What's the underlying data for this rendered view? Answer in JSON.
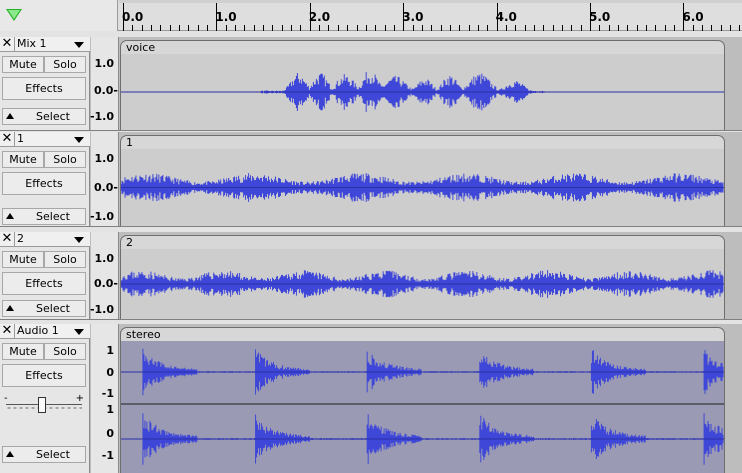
{
  "timeline": {
    "ticks": [
      "0.0",
      "1.0",
      "2.0",
      "3.0",
      "4.0",
      "5.0",
      "6.0"
    ]
  },
  "tracks": [
    {
      "name": "Mix 1",
      "clip": "voice",
      "mute": "Mute",
      "solo": "Solo",
      "effects": "Effects",
      "select": "Select",
      "scale": [
        "1.0",
        "0.0-",
        "-1.0"
      ]
    },
    {
      "name": "1",
      "clip": "1",
      "mute": "Mute",
      "solo": "Solo",
      "effects": "Effects",
      "select": "Select",
      "scale": [
        "1.0",
        "0.0-",
        "-1.0"
      ]
    },
    {
      "name": "2",
      "clip": "2",
      "mute": "Mute",
      "solo": "Solo",
      "effects": "Effects",
      "select": "Select",
      "scale": [
        "1.0",
        "0.0-",
        "-1.0"
      ]
    },
    {
      "name": "Audio 1",
      "clip": "stereo",
      "mute": "Mute",
      "solo": "Solo",
      "effects": "Effects",
      "select": "Select",
      "pan_minus": "-",
      "pan_plus": "+",
      "scale_top": [
        "1",
        "0",
        "-1"
      ],
      "scale_bottom": [
        "1",
        "0",
        "-1"
      ]
    }
  ],
  "colors": {
    "waveform": "#3f47d8",
    "waveform_dark": "#2a2fa6",
    "background_unselected": "#cdcdcd",
    "background_selected": "#9a9ab4",
    "playhead": "#23b223"
  }
}
